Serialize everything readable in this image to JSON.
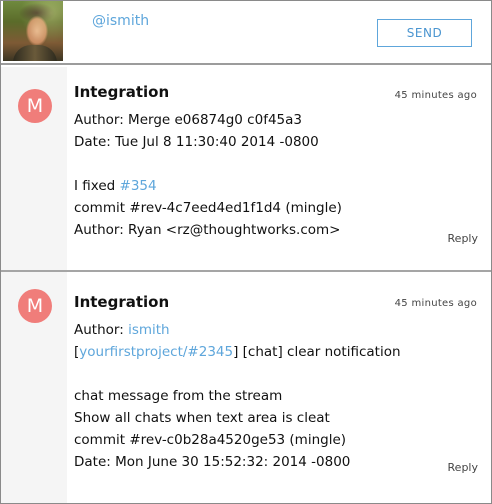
{
  "compose": {
    "mention_text": "@ismith",
    "send_label": "SEND"
  },
  "messages": [
    {
      "avatar_letter": "M",
      "title": "Integration",
      "time": "45 minutes ago",
      "lines": {
        "l1": "Author: Merge e06874g0 c0f45a3",
        "l2": "Date: Tue Jul 8 11:30:40 2014 -0800",
        "l3_prefix": "I fixed ",
        "l3_link": "#354",
        "l4": "commit #rev-4c7eed4ed1f1d4 (mingle)",
        "l5": "Author: Ryan <rz@thoughtworks.com>"
      },
      "reply_label": "Reply"
    },
    {
      "avatar_letter": "M",
      "title": "Integration",
      "time": "45 minutes ago",
      "lines": {
        "l1_prefix": "Author: ",
        "l1_link": "ismith",
        "l2_open": "[",
        "l2_link": "yourfirstproject/#2345",
        "l2_rest": "] [chat] clear notification",
        "l3": "chat message from the stream",
        "l4": "Show all chats when text area is cleat",
        "l5": "commit #rev-c0b28a4520ge53 (mingle)",
        "l6": "Date: Mon June 30 15:52:32: 2014 -0800"
      },
      "reply_label": "Reply"
    }
  ],
  "colors": {
    "link": "#5ea6db",
    "badge": "#f07d7a",
    "gutter": "#f5f5f5"
  }
}
